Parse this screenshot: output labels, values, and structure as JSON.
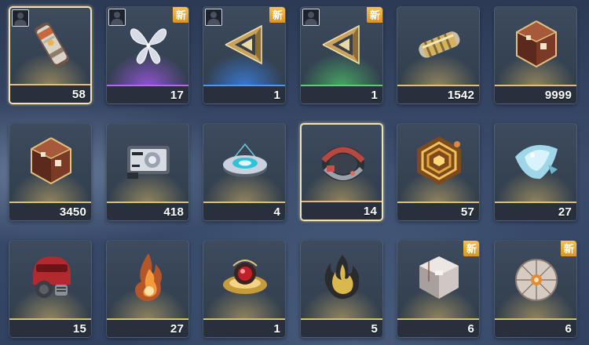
{
  "inventory": {
    "items": [
      {
        "id": "canister",
        "count": "58",
        "rarity": "gold",
        "selected": true,
        "is_new": false,
        "has_owner_icon": true,
        "icon": "canister-item-icon"
      },
      {
        "id": "crystal-butterfly",
        "count": "17",
        "rarity": "purple",
        "selected": false,
        "is_new": true,
        "has_owner_icon": true,
        "icon": "butterfly-item-icon"
      },
      {
        "id": "gold-pyramid-blue",
        "count": "1",
        "rarity": "blue",
        "selected": false,
        "is_new": true,
        "has_owner_icon": true,
        "icon": "pyramid-item-icon"
      },
      {
        "id": "gold-pyramid-green",
        "count": "1",
        "rarity": "green",
        "selected": false,
        "is_new": true,
        "has_owner_icon": true,
        "icon": "pyramid-item-icon"
      },
      {
        "id": "gold-capsule",
        "count": "1542",
        "rarity": "gold",
        "selected": false,
        "is_new": false,
        "has_owner_icon": false,
        "icon": "capsule-item-icon"
      },
      {
        "id": "polyhedral-crate-a",
        "count": "9999",
        "rarity": "gold",
        "selected": false,
        "is_new": false,
        "has_owner_icon": false,
        "icon": "polyhedron-item-icon"
      },
      {
        "id": "polyhedral-crate-b",
        "count": "3450",
        "rarity": "gold",
        "selected": false,
        "is_new": false,
        "has_owner_icon": false,
        "icon": "polyhedron-item-icon"
      },
      {
        "id": "device-pack",
        "count": "418",
        "rarity": "gold",
        "selected": false,
        "is_new": false,
        "has_owner_icon": false,
        "icon": "device-item-icon"
      },
      {
        "id": "holo-disc",
        "count": "4",
        "rarity": "gold",
        "selected": false,
        "is_new": false,
        "has_owner_icon": false,
        "icon": "disc-item-icon"
      },
      {
        "id": "mech-ring",
        "count": "14",
        "rarity": "gold",
        "selected": true,
        "is_new": false,
        "has_owner_icon": false,
        "icon": "ring-item-icon"
      },
      {
        "id": "gold-hexagon",
        "count": "57",
        "rarity": "gold",
        "selected": false,
        "is_new": false,
        "has_owner_icon": false,
        "icon": "hexagon-item-icon"
      },
      {
        "id": "cyan-crystal",
        "count": "27",
        "rarity": "gold",
        "selected": false,
        "is_new": false,
        "has_owner_icon": false,
        "icon": "crystal-item-icon"
      },
      {
        "id": "red-helmet",
        "count": "15",
        "rarity": "gold",
        "selected": false,
        "is_new": false,
        "has_owner_icon": false,
        "icon": "helmet-item-icon"
      },
      {
        "id": "flame-orb",
        "count": "27",
        "rarity": "gold",
        "selected": false,
        "is_new": false,
        "has_owner_icon": false,
        "icon": "flame-item-icon"
      },
      {
        "id": "red-core-ring",
        "count": "1",
        "rarity": "gold",
        "selected": false,
        "is_new": false,
        "has_owner_icon": false,
        "icon": "core-item-icon"
      },
      {
        "id": "dark-flame",
        "count": "5",
        "rarity": "gold",
        "selected": false,
        "is_new": false,
        "has_owner_icon": false,
        "icon": "dark-flame-item-icon"
      },
      {
        "id": "white-cube",
        "count": "6",
        "rarity": "gold",
        "selected": false,
        "is_new": true,
        "has_owner_icon": false,
        "icon": "cube-item-icon"
      },
      {
        "id": "cracked-sphere",
        "count": "6",
        "rarity": "gold",
        "selected": false,
        "is_new": true,
        "has_owner_icon": false,
        "icon": "sphere-item-icon"
      }
    ],
    "new_badge_label": "新"
  }
}
